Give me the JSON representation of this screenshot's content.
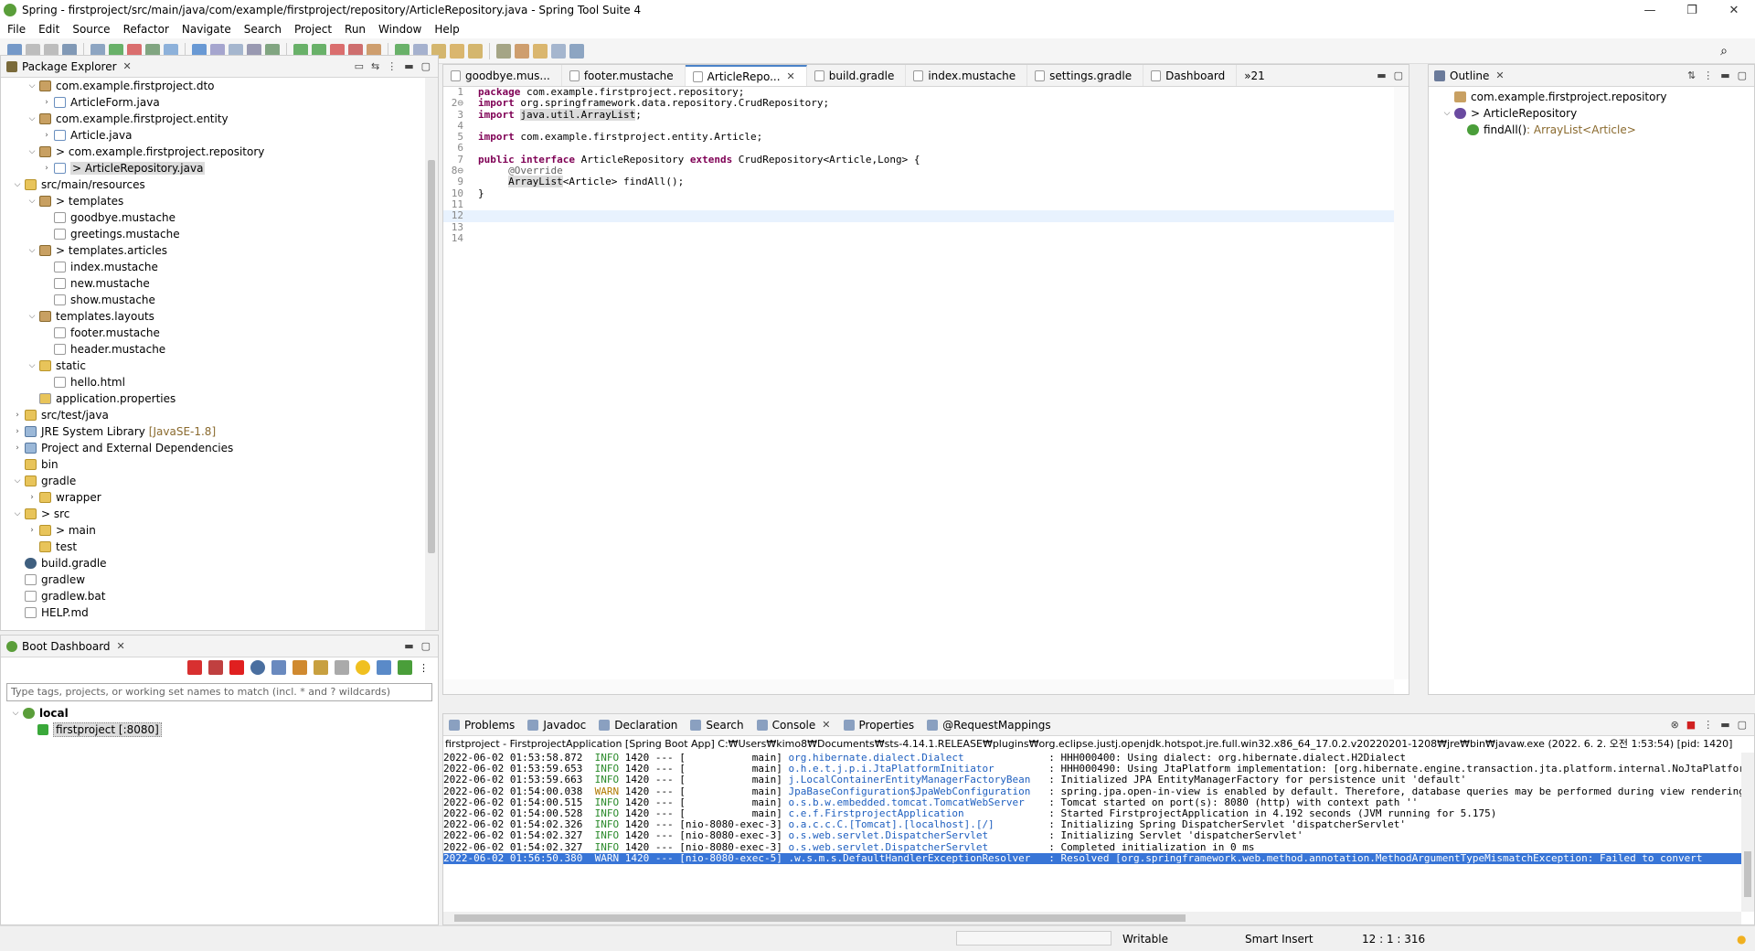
{
  "window": {
    "title": "Spring - firstproject/src/main/java/com/example/firstproject/repository/ArticleRepository.java - Spring Tool Suite 4",
    "min": "—",
    "max": "❐",
    "close": "✕"
  },
  "menu": [
    "File",
    "Edit",
    "Source",
    "Refactor",
    "Navigate",
    "Search",
    "Project",
    "Run",
    "Window",
    "Help"
  ],
  "package_explorer": {
    "title": "Package Explorer",
    "items": [
      {
        "indent": 2,
        "tw": "⌵",
        "icon": "pkg",
        "label": "com.example.firstproject.dto"
      },
      {
        "indent": 3,
        "tw": "›",
        "icon": "java",
        "label": "ArticleForm.java"
      },
      {
        "indent": 2,
        "tw": "⌵",
        "icon": "pkg",
        "label": "com.example.firstproject.entity"
      },
      {
        "indent": 3,
        "tw": "›",
        "icon": "java",
        "label": "Article.java"
      },
      {
        "indent": 2,
        "tw": "⌵",
        "icon": "pkg",
        "label": "> com.example.firstproject.repository"
      },
      {
        "indent": 3,
        "tw": "›",
        "icon": "java",
        "label": "> ArticleRepository.java",
        "selected": true
      },
      {
        "indent": 1,
        "tw": "⌵",
        "icon": "folder",
        "label": "src/main/resources"
      },
      {
        "indent": 2,
        "tw": "⌵",
        "icon": "pkg",
        "label": "> templates"
      },
      {
        "indent": 3,
        "tw": "",
        "icon": "file",
        "label": "goodbye.mustache"
      },
      {
        "indent": 3,
        "tw": "",
        "icon": "file",
        "label": "greetings.mustache"
      },
      {
        "indent": 2,
        "tw": "⌵",
        "icon": "pkg",
        "label": "> templates.articles"
      },
      {
        "indent": 3,
        "tw": "",
        "icon": "file",
        "label": "index.mustache"
      },
      {
        "indent": 3,
        "tw": "",
        "icon": "file",
        "label": "new.mustache"
      },
      {
        "indent": 3,
        "tw": "",
        "icon": "file",
        "label": "show.mustache"
      },
      {
        "indent": 2,
        "tw": "⌵",
        "icon": "pkg",
        "label": "templates.layouts"
      },
      {
        "indent": 3,
        "tw": "",
        "icon": "file",
        "label": "footer.mustache"
      },
      {
        "indent": 3,
        "tw": "",
        "icon": "file",
        "label": "header.mustache"
      },
      {
        "indent": 2,
        "tw": "⌵",
        "icon": "folder",
        "label": "static"
      },
      {
        "indent": 3,
        "tw": "",
        "icon": "file",
        "label": "hello.html"
      },
      {
        "indent": 2,
        "tw": "",
        "icon": "prop",
        "label": "application.properties"
      },
      {
        "indent": 1,
        "tw": "›",
        "icon": "folder",
        "label": "src/test/java"
      },
      {
        "indent": 1,
        "tw": "›",
        "icon": "lib",
        "label": "JRE System Library",
        "extra": "[JavaSE-1.8]"
      },
      {
        "indent": 1,
        "tw": "›",
        "icon": "lib",
        "label": "Project and External Dependencies"
      },
      {
        "indent": 1,
        "tw": "",
        "icon": "folder",
        "label": "bin"
      },
      {
        "indent": 1,
        "tw": "⌵",
        "icon": "folder",
        "label": "gradle"
      },
      {
        "indent": 2,
        "tw": "›",
        "icon": "folder",
        "label": "wrapper"
      },
      {
        "indent": 1,
        "tw": "⌵",
        "icon": "folder",
        "label": "> src"
      },
      {
        "indent": 2,
        "tw": "›",
        "icon": "folder",
        "label": "> main"
      },
      {
        "indent": 2,
        "tw": "",
        "icon": "folder",
        "label": "test"
      },
      {
        "indent": 1,
        "tw": "",
        "icon": "gradle",
        "label": "build.gradle"
      },
      {
        "indent": 1,
        "tw": "",
        "icon": "file",
        "label": "gradlew"
      },
      {
        "indent": 1,
        "tw": "",
        "icon": "file",
        "label": "gradlew.bat"
      },
      {
        "indent": 1,
        "tw": "",
        "icon": "file",
        "label": "HELP.md"
      }
    ]
  },
  "boot_dashboard": {
    "title": "Boot Dashboard",
    "filter_placeholder": "Type tags, projects, or working set names to match (incl. * and ? wildcards)",
    "local": "local",
    "app": "firstproject [:8080]"
  },
  "editor": {
    "tabs": [
      {
        "label": "goodbye.mus..."
      },
      {
        "label": "footer.mustache"
      },
      {
        "label": "ArticleRepo...",
        "active": true
      },
      {
        "label": "build.gradle"
      },
      {
        "label": "index.mustache"
      },
      {
        "label": "settings.gradle"
      },
      {
        "label": "Dashboard"
      }
    ],
    "overflow": "»21",
    "lines": [
      {
        "n": "1",
        "segs": [
          {
            "t": "package",
            "c": "kw"
          },
          {
            "t": " com.example.firstproject.repository;"
          }
        ]
      },
      {
        "n": "2⊖",
        "segs": [
          {
            "t": "import",
            "c": "kw"
          },
          {
            "t": " org.springframework.data.repository.CrudRepository;"
          }
        ]
      },
      {
        "n": "3",
        "segs": [
          {
            "t": "import",
            "c": "kw"
          },
          {
            "t": " "
          },
          {
            "t": "java.util.ArrayList",
            "c": "hl"
          },
          {
            "t": ";"
          }
        ]
      },
      {
        "n": "4",
        "segs": []
      },
      {
        "n": "5",
        "segs": [
          {
            "t": "import",
            "c": "kw"
          },
          {
            "t": " com.example.firstproject.entity.Article;"
          }
        ]
      },
      {
        "n": "6",
        "segs": []
      },
      {
        "n": "7",
        "segs": [
          {
            "t": "public",
            "c": "kw"
          },
          {
            "t": " "
          },
          {
            "t": "interface",
            "c": "kw"
          },
          {
            "t": " ArticleRepository "
          },
          {
            "t": "extends",
            "c": "kw"
          },
          {
            "t": " CrudRepository<Article,Long> {"
          }
        ]
      },
      {
        "n": "8⊖",
        "segs": [
          {
            "t": "     "
          },
          {
            "t": "@Override",
            "c": "ann"
          }
        ]
      },
      {
        "n": "9",
        "segs": [
          {
            "t": "     "
          },
          {
            "t": "ArrayList",
            "c": "hl"
          },
          {
            "t": "<Article> findAll();"
          }
        ]
      },
      {
        "n": "10",
        "segs": [
          {
            "t": "}"
          }
        ]
      },
      {
        "n": "11",
        "segs": []
      },
      {
        "n": "12",
        "segs": [],
        "current": true
      },
      {
        "n": "13",
        "segs": []
      },
      {
        "n": "14",
        "segs": []
      }
    ]
  },
  "outline": {
    "title": "Outline",
    "items": [
      {
        "indent": 1,
        "label": "com.example.firstproject.repository"
      },
      {
        "indent": 1,
        "label": "> ArticleRepository",
        "tw": "⌵"
      },
      {
        "indent": 2,
        "label": "findAll()",
        "type": " : ArrayList<Article>"
      }
    ]
  },
  "console": {
    "tabs": [
      "Problems",
      "Javadoc",
      "Declaration",
      "Search",
      "Console",
      "Properties",
      "@RequestMappings"
    ],
    "header": "firstproject - FirstprojectApplication [Spring Boot App] C:₩Users₩kimo8₩Documents₩sts-4.14.1.RELEASE₩plugins₩org.eclipse.justj.openjdk.hotspot.jre.full.win32.x86_64_17.0.2.v20220201-1208₩jre₩bin₩javaw.exe  (2022. 6. 2. 오전 1:53:54) [pid: 1420]",
    "rows": [
      {
        "ts": "2022-06-02 01:53:58.872",
        "lvl": "INFO",
        "pid": "1420 --- [           main]",
        "logger": "org.hibernate.dialect.Dialect              ",
        "msg": ": HHH000400: Using dialect: org.hibernate.dialect.H2Dialect"
      },
      {
        "ts": "2022-06-02 01:53:59.653",
        "lvl": "INFO",
        "pid": "1420 --- [           main]",
        "logger": "o.h.e.t.j.p.i.JtaPlatformInitiator         ",
        "msg": ": HHH000490: Using JtaPlatform implementation: [org.hibernate.engine.transaction.jta.platform.internal.NoJtaPlatform]"
      },
      {
        "ts": "2022-06-02 01:53:59.663",
        "lvl": "INFO",
        "pid": "1420 --- [           main]",
        "logger": "j.LocalContainerEntityManagerFactoryBean   ",
        "msg": ": Initialized JPA EntityManagerFactory for persistence unit 'default'"
      },
      {
        "ts": "2022-06-02 01:54:00.038",
        "lvl": "WARN",
        "pid": "1420 --- [           main]",
        "logger": "JpaBaseConfiguration$JpaWebConfiguration   ",
        "msg": ": spring.jpa.open-in-view is enabled by default. Therefore, database queries may be performed during view rendering."
      },
      {
        "ts": "2022-06-02 01:54:00.515",
        "lvl": "INFO",
        "pid": "1420 --- [           main]",
        "logger": "o.s.b.w.embedded.tomcat.TomcatWebServer    ",
        "msg": ": Tomcat started on port(s): 8080 (http) with context path ''"
      },
      {
        "ts": "2022-06-02 01:54:00.528",
        "lvl": "INFO",
        "pid": "1420 --- [           main]",
        "logger": "c.e.f.FirstprojectApplication              ",
        "msg": ": Started FirstprojectApplication in 4.192 seconds (JVM running for 5.175)"
      },
      {
        "ts": "2022-06-02 01:54:02.326",
        "lvl": "INFO",
        "pid": "1420 --- [nio-8080-exec-3]",
        "logger": "o.a.c.c.C.[Tomcat].[localhost].[/]         ",
        "msg": ": Initializing Spring DispatcherServlet 'dispatcherServlet'"
      },
      {
        "ts": "2022-06-02 01:54:02.327",
        "lvl": "INFO",
        "pid": "1420 --- [nio-8080-exec-3]",
        "logger": "o.s.web.servlet.DispatcherServlet          ",
        "msg": ": Initializing Servlet 'dispatcherServlet'"
      },
      {
        "ts": "2022-06-02 01:54:02.327",
        "lvl": "INFO",
        "pid": "1420 --- [nio-8080-exec-3]",
        "logger": "o.s.web.servlet.DispatcherServlet          ",
        "msg": ": Completed initialization in 0 ms"
      },
      {
        "ts": "2022-06-02 01:56:50.380",
        "lvl": "WARN",
        "pid": "1420 --- [nio-8080-exec-5]",
        "logger": ".w.s.m.s.DefaultHandlerExceptionResolver   ",
        "msg": ": Resolved [org.springframework.web.method.annotation.MethodArgumentTypeMismatchException: Failed to convert",
        "selected": true
      }
    ]
  },
  "status": {
    "writable": "Writable",
    "insert": "Smart Insert",
    "position": "12 : 1 : 316"
  }
}
